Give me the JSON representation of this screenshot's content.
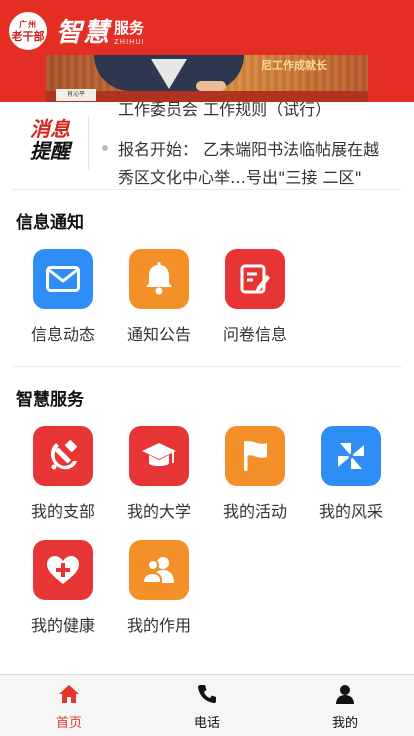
{
  "header": {
    "logo_badge": [
      "广州",
      "老干部"
    ],
    "brand_cn": "智慧",
    "brand_service": "服务",
    "brand_en": "ZHIHUI",
    "banner_nameplate": "肖沁平",
    "banner_screen_text": "尼工作成就长"
  },
  "notice": {
    "logo_line1": "消息",
    "logo_line2": "提醒",
    "lines": [
      "工作委员会 工作规则（试行）",
      "报名开始：  乙未端阳书法临帖展在越",
      "秀区文化中心举…号出\"三接  二区\""
    ]
  },
  "sections": {
    "info_title": "信息通知",
    "info_items": [
      {
        "label": "信息动态",
        "icon": "mail-icon"
      },
      {
        "label": "通知公告",
        "icon": "bell-icon"
      },
      {
        "label": "问卷信息",
        "icon": "survey-edit-icon"
      }
    ],
    "service_title": "智慧服务",
    "service_items": [
      {
        "label": "我的支部",
        "icon": "hammer-sickle-icon"
      },
      {
        "label": "我的大学",
        "icon": "graduation-cap-icon"
      },
      {
        "label": "我的活动",
        "icon": "flag-icon"
      },
      {
        "label": "我的风采",
        "icon": "pinwheel-icon"
      },
      {
        "label": "我的健康",
        "icon": "heart-plus-icon"
      },
      {
        "label": "我的作用",
        "icon": "users-icon"
      }
    ]
  },
  "tabbar": {
    "items": [
      {
        "label": "首页",
        "icon": "home-icon",
        "active": true
      },
      {
        "label": "电话",
        "icon": "phone-icon",
        "active": false
      },
      {
        "label": "我的",
        "icon": "user-icon",
        "active": false
      }
    ]
  },
  "colors": {
    "brand_red": "#e42d23",
    "blue": "#2e8ef5",
    "orange": "#f3902a",
    "red": "#e73535",
    "active_tab": "#e4362d"
  }
}
